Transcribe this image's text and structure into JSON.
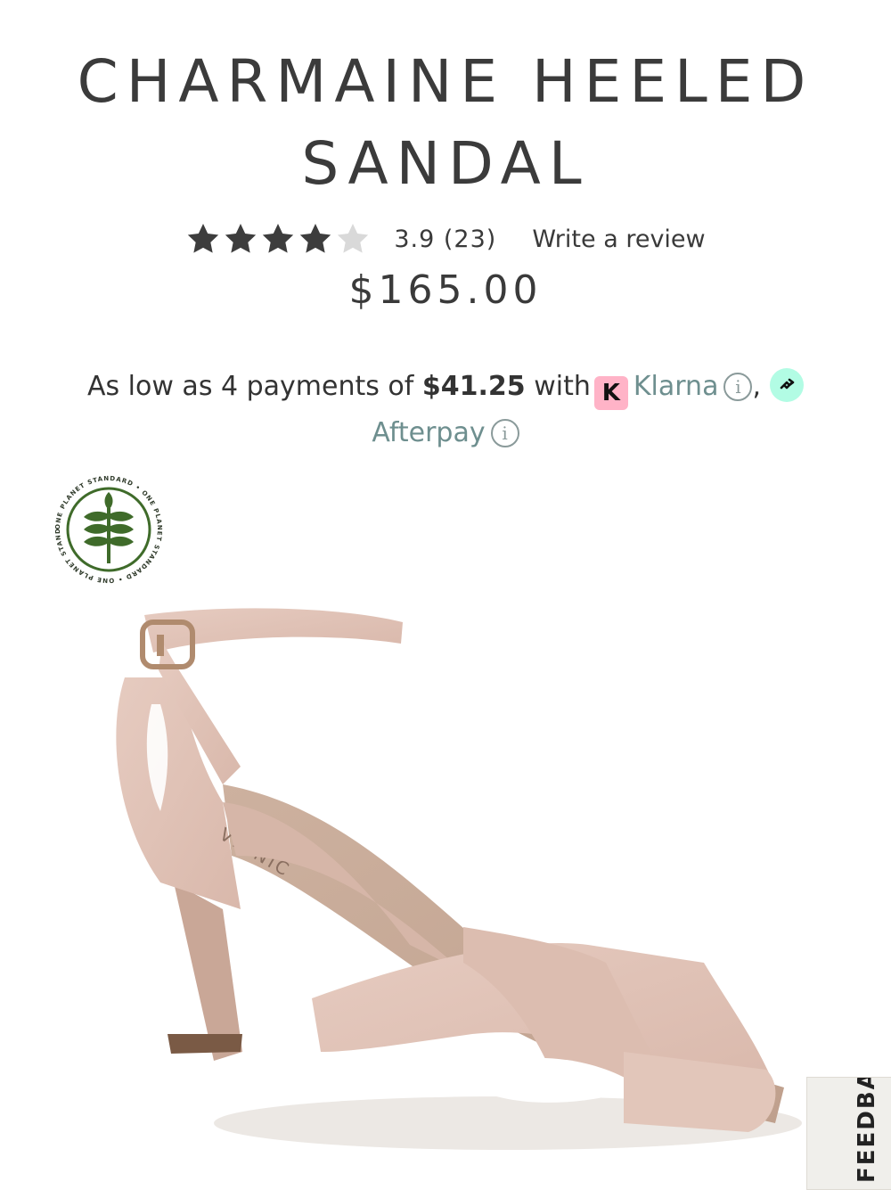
{
  "product": {
    "title_line1": "CHARMAINE HEELED",
    "title_line2": "SANDAL",
    "rating": {
      "value": 3.9,
      "stars_filled": 4,
      "stars_total": 5,
      "display": "3.9 (23)",
      "write_review_label": "Write a review"
    },
    "price": "$165.00"
  },
  "payments": {
    "prefix": "As low as 4 payments of",
    "amount": "$41.25",
    "with": "with",
    "klarna_badge": "K",
    "klarna_label": "Klarna",
    "separator": ",",
    "afterpay_label": "Afterpay",
    "info_glyph": "i"
  },
  "feedback": {
    "label": "FEEDBACK"
  },
  "colors": {
    "klarna_pink": "#ffb3c7",
    "afterpay_mint": "#b2fce4",
    "link_teal": "#6e8f8f",
    "badge_green": "#3f6b2a"
  },
  "icons": {
    "star": "star-icon",
    "info": "info-icon",
    "badge": "one-planet-standard-badge",
    "afterpay": "afterpay-logo-icon"
  }
}
